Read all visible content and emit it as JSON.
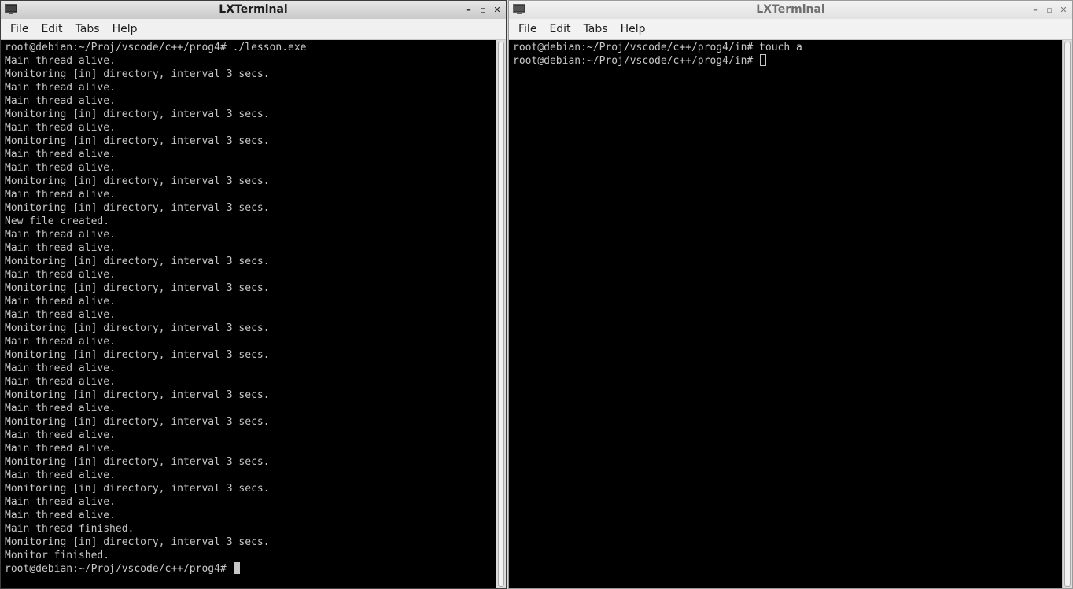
{
  "left_window": {
    "title": "LXTerminal",
    "menu": [
      "File",
      "Edit",
      "Tabs",
      "Help"
    ],
    "lines": [
      "root@debian:~/Proj/vscode/c++/prog4# ./lesson.exe",
      "Main thread alive.",
      "Monitoring [in] directory, interval 3 secs.",
      "Main thread alive.",
      "Main thread alive.",
      "Monitoring [in] directory, interval 3 secs.",
      "Main thread alive.",
      "Monitoring [in] directory, interval 3 secs.",
      "Main thread alive.",
      "Main thread alive.",
      "Monitoring [in] directory, interval 3 secs.",
      "Main thread alive.",
      "Monitoring [in] directory, interval 3 secs.",
      "New file created.",
      "Main thread alive.",
      "Main thread alive.",
      "Monitoring [in] directory, interval 3 secs.",
      "Main thread alive.",
      "Monitoring [in] directory, interval 3 secs.",
      "Main thread alive.",
      "Main thread alive.",
      "Monitoring [in] directory, interval 3 secs.",
      "Main thread alive.",
      "Monitoring [in] directory, interval 3 secs.",
      "Main thread alive.",
      "Main thread alive.",
      "Monitoring [in] directory, interval 3 secs.",
      "Main thread alive.",
      "Monitoring [in] directory, interval 3 secs.",
      "Main thread alive.",
      "Main thread alive.",
      "Monitoring [in] directory, interval 3 secs.",
      "Main thread alive.",
      "Monitoring [in] directory, interval 3 secs.",
      "Main thread alive.",
      "Main thread alive.",
      "Main thread finished.",
      "Monitoring [in] directory, interval 3 secs.",
      "Monitor finished."
    ],
    "prompt": "root@debian:~/Proj/vscode/c++/prog4# "
  },
  "right_window": {
    "title": "LXTerminal",
    "menu": [
      "File",
      "Edit",
      "Tabs",
      "Help"
    ],
    "lines": [
      "root@debian:~/Proj/vscode/c++/prog4/in# touch a"
    ],
    "prompt": "root@debian:~/Proj/vscode/c++/prog4/in# "
  },
  "icons": {
    "app": "terminal-icon",
    "minimize": "minimize-icon",
    "maximize": "maximize-icon",
    "close": "close-icon"
  },
  "colors": {
    "terminal_bg": "#000000",
    "terminal_fg": "#c7c7c7"
  }
}
